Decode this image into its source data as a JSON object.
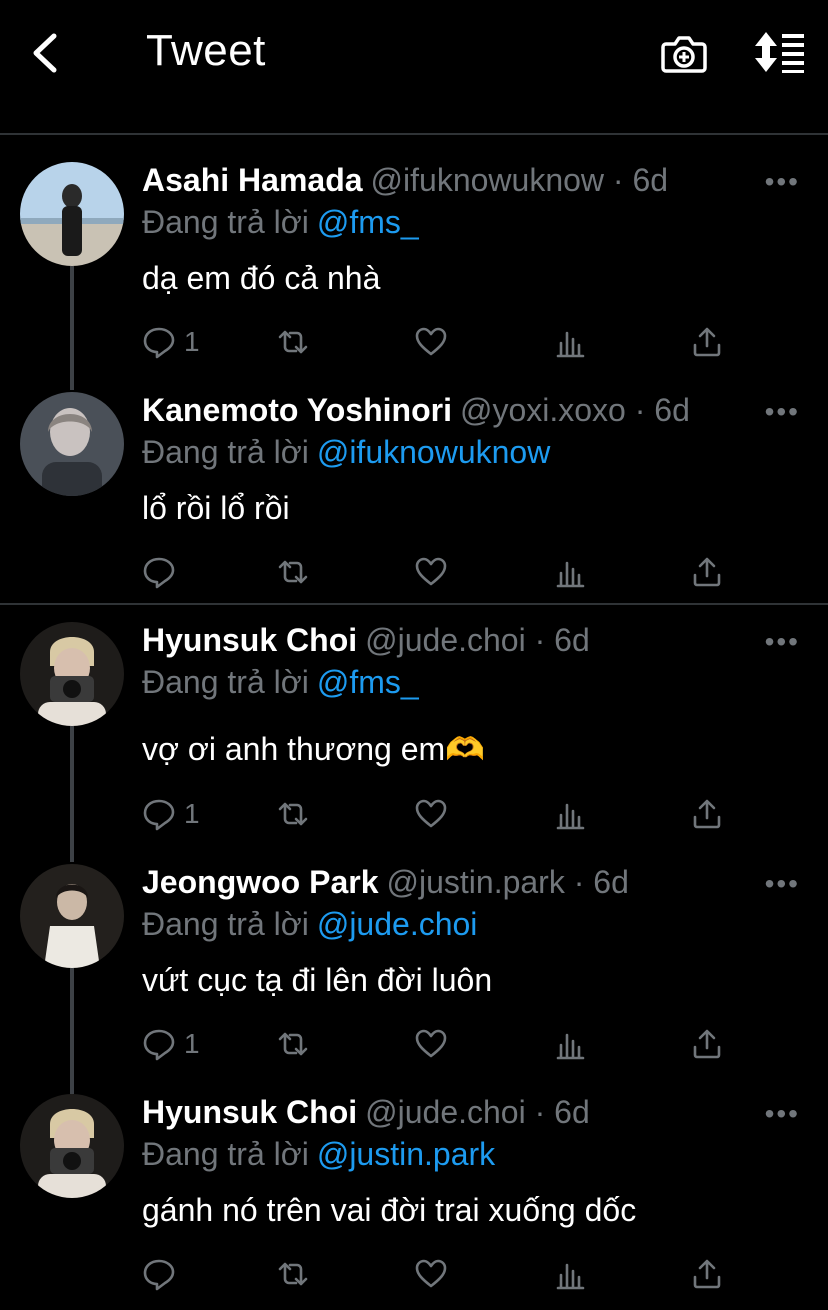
{
  "header": {
    "title": "Tweet",
    "back_icon": "chevron-left-icon",
    "camera_icon": "camera-plus-icon",
    "sort_icon": "sort-list-icon"
  },
  "reply_prefix": "Đang trả lời",
  "tweets": [
    {
      "name": "Asahi Hamada",
      "handle": "@ifuknowuknow · 6d",
      "reply_to": "@fms_",
      "text": "dạ em đó cả nhà",
      "reply_count": "1"
    },
    {
      "name": "Kanemoto Yoshinori",
      "handle": "@yoxi.xoxo · 6d",
      "reply_to": "@ifuknowuknow",
      "text": "lổ rồi lổ rồi",
      "reply_count": ""
    },
    {
      "name": "Hyunsuk Choi",
      "handle": "@jude.choi · 6d",
      "reply_to": "@fms_",
      "text": "vợ ơi anh thương em🫶",
      "reply_count": "1"
    },
    {
      "name": "Jeongwoo Park",
      "handle": "@justin.park · 6d",
      "reply_to": "@jude.choi",
      "text": "vứt cục tạ đi lên đời luôn",
      "reply_count": "1"
    },
    {
      "name": "Hyunsuk Choi",
      "handle": "@jude.choi · 6d",
      "reply_to": "@justin.park",
      "text": "gánh nó trên vai đời trai xuống dốc",
      "reply_count": ""
    }
  ],
  "colors": {
    "background": "#000000",
    "accent": "#1d9bf0",
    "muted": "#71767b",
    "divider": "#2f3336"
  }
}
